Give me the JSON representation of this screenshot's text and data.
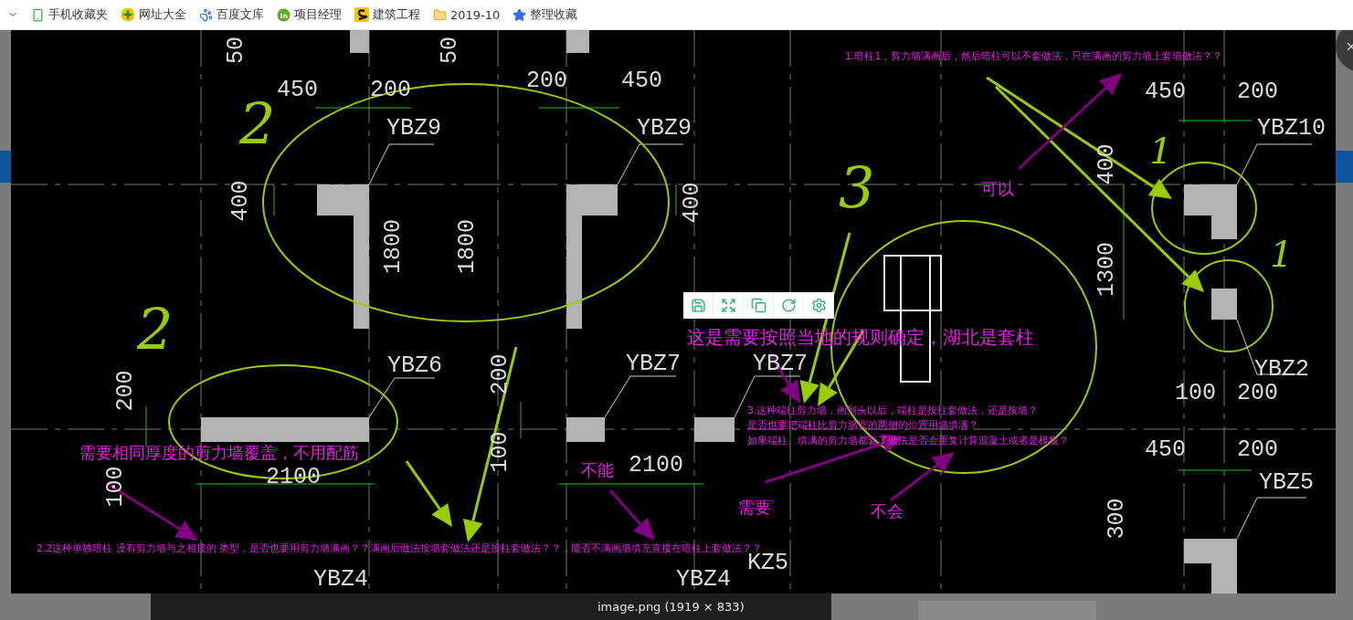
{
  "bookmarks": [
    {
      "label": "手机收藏夹",
      "kind": "phone"
    },
    {
      "label": "网址大全",
      "kind": "plus"
    },
    {
      "label": "百度文库",
      "kind": "paw"
    },
    {
      "label": "项目经理",
      "kind": "leaf"
    },
    {
      "label": "建筑工程",
      "kind": "tile"
    },
    {
      "label": "2019-10",
      "kind": "folder"
    },
    {
      "label": "整理收藏",
      "kind": "star"
    }
  ],
  "viewer": {
    "caption": "image.png (1919 × 833)"
  },
  "drawing": {
    "labels": [
      {
        "text": "50",
        "kind": "vertical"
      },
      {
        "text": "50",
        "kind": "vertical"
      },
      {
        "text": "450",
        "kind": "dimension"
      },
      {
        "text": "200",
        "kind": "dimension"
      },
      {
        "text": "200",
        "kind": "dimension"
      },
      {
        "text": "450",
        "kind": "dimension"
      },
      {
        "text": "YBZ9",
        "kind": "dimension"
      },
      {
        "text": "YBZ9",
        "kind": "dimension"
      },
      {
        "text": "400",
        "kind": "vertical"
      },
      {
        "text": "400",
        "kind": "vertical"
      },
      {
        "text": "1800",
        "kind": "vertical"
      },
      {
        "text": "1800",
        "kind": "vertical"
      },
      {
        "text": "YBZ6",
        "kind": "dimension"
      },
      {
        "text": "YBZ7",
        "kind": "dimension"
      },
      {
        "text": "YBZ7",
        "kind": "dimension"
      },
      {
        "text": "200",
        "kind": "vertical"
      },
      {
        "text": "200",
        "kind": "vertical"
      },
      {
        "text": "100",
        "kind": "vertical"
      },
      {
        "text": "2100",
        "kind": "dimension"
      },
      {
        "text": "100",
        "kind": "vertical"
      },
      {
        "text": "2100",
        "kind": "dimension"
      },
      {
        "text": "450",
        "kind": "dimension"
      },
      {
        "text": "200",
        "kind": "dimension"
      },
      {
        "text": "YBZ10",
        "kind": "dimension"
      },
      {
        "text": "400",
        "kind": "vertical"
      },
      {
        "text": "1300",
        "kind": "vertical"
      },
      {
        "text": "YBZ2",
        "kind": "dimension"
      },
      {
        "text": "100",
        "kind": "dimension"
      },
      {
        "text": "200",
        "kind": "dimension"
      },
      {
        "text": "450",
        "kind": "dimension"
      },
      {
        "text": "200",
        "kind": "dimension"
      },
      {
        "text": "YBZ5",
        "kind": "dimension"
      },
      {
        "text": "300",
        "kind": "vertical"
      },
      {
        "text": "YBZ4",
        "kind": "dimension"
      },
      {
        "text": "YBZ4",
        "kind": "dimension"
      },
      {
        "text": "KZ5",
        "kind": "dimension"
      }
    ],
    "handwritten": [
      "2",
      "2",
      "3",
      "1",
      "1"
    ],
    "notes": [
      {
        "text": "1.暗柱1，剪力墙满画后，然后暗柱可以不套做法，只在满画的剪力墙上套墙做法？？",
        "kind": "question"
      },
      {
        "text": "可以",
        "kind": "answer"
      },
      {
        "text": "这是需要按照当地的规则确定，湖北是套柱",
        "kind": "headline"
      },
      {
        "text": "3.这种端柱剪力墙，画到头以后，端柱是按柱套做法，还是按墙？",
        "kind": "question"
      },
      {
        "text": "是否也要把端柱比剪力墙宽的两侧的位置用墙填满？",
        "kind": "question"
      },
      {
        "text": "如果端柱、填满的剪力墙都套了做法是否会重复计算混凝土或者是模板？",
        "kind": "question"
      },
      {
        "text": "需要相同厚度的剪力墙覆盖，不用配筋",
        "kind": "answer"
      },
      {
        "text": "不能",
        "kind": "answer"
      },
      {
        "text": "需要",
        "kind": "answer"
      },
      {
        "text": "不会",
        "kind": "answer"
      },
      {
        "text": "2.2这种单独暗柱 没有剪力墙与之相接的 类型，是否也要用剪力墙满画？？满画后做法按墙套做法还是按柱套做法？？，能否不满画墙填充直接在暗柱上套做法？？",
        "kind": "question"
      }
    ]
  }
}
